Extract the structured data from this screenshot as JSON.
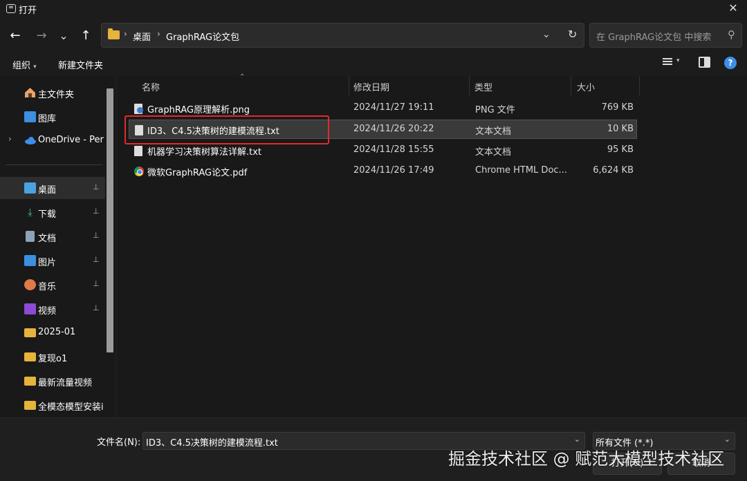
{
  "window": {
    "title": "打开",
    "close": "✕"
  },
  "nav": {
    "back": "←",
    "forward": "→",
    "recent": "⌄",
    "up": "↑",
    "breadcrumb": [
      "桌面",
      "GraphRAG论文包"
    ],
    "search_placeholder": "在 GraphRAG论文包 中搜索"
  },
  "commands": {
    "organize": "组织",
    "new_folder": "新建文件夹"
  },
  "sidebar": {
    "quick": [
      {
        "label": "主文件夹",
        "icon": "home-icon"
      },
      {
        "label": "图库",
        "icon": "gallery-icon"
      },
      {
        "label": "OneDrive - Per",
        "icon": "cloud-icon"
      }
    ],
    "pinned": [
      {
        "label": "桌面",
        "icon": "desktop-icon",
        "pin": "📌"
      },
      {
        "label": "下载",
        "icon": "download-icon",
        "pin": "📌"
      },
      {
        "label": "文档",
        "icon": "document-icon",
        "pin": "📌"
      },
      {
        "label": "图片",
        "icon": "picture-icon",
        "pin": "📌"
      },
      {
        "label": "音乐",
        "icon": "music-icon",
        "pin": "📌"
      },
      {
        "label": "视频",
        "icon": "video-icon",
        "pin": "📌"
      },
      {
        "label": "2025-01",
        "icon": "folder-icon"
      },
      {
        "label": "复现o1",
        "icon": "folder-icon"
      },
      {
        "label": "最新流量视频",
        "icon": "folder-icon"
      },
      {
        "label": "全模态模型安装i",
        "icon": "folder-icon"
      }
    ]
  },
  "columns": {
    "name": "名称",
    "modified": "修改日期",
    "type": "类型",
    "size": "大小"
  },
  "files": [
    {
      "name": "GraphRAG原理解析.png",
      "modified": "2024/11/27 19:11",
      "type": "PNG 文件",
      "size": "769 KB",
      "icon": "image-file-icon"
    },
    {
      "name": "ID3、C4.5决策树的建模流程.txt",
      "modified": "2024/11/26 20:22",
      "type": "文本文档",
      "size": "10 KB",
      "icon": "text-file-icon"
    },
    {
      "name": "机器学习决策树算法详解.txt",
      "modified": "2024/11/28 15:55",
      "type": "文本文档",
      "size": "95 KB",
      "icon": "text-file-icon"
    },
    {
      "name": "微软GraphRAG论文.pdf",
      "modified": "2024/11/26 17:49",
      "type": "Chrome HTML Doc...",
      "size": "6,624 KB",
      "icon": "chrome-icon"
    }
  ],
  "footer": {
    "filename_label": "文件名(N):",
    "filename_value": "ID3、C4.5决策树的建模流程.txt",
    "filetype_value": "所有文件 (*.*)",
    "open_button": "打开(O)",
    "cancel_button": "取消"
  },
  "watermark": "掘金技术社区 @ 赋范大模型技术社区",
  "colors": {
    "background": "#1c1c1c",
    "highlight": "#e42a2a",
    "folder": "#e6b33b"
  }
}
